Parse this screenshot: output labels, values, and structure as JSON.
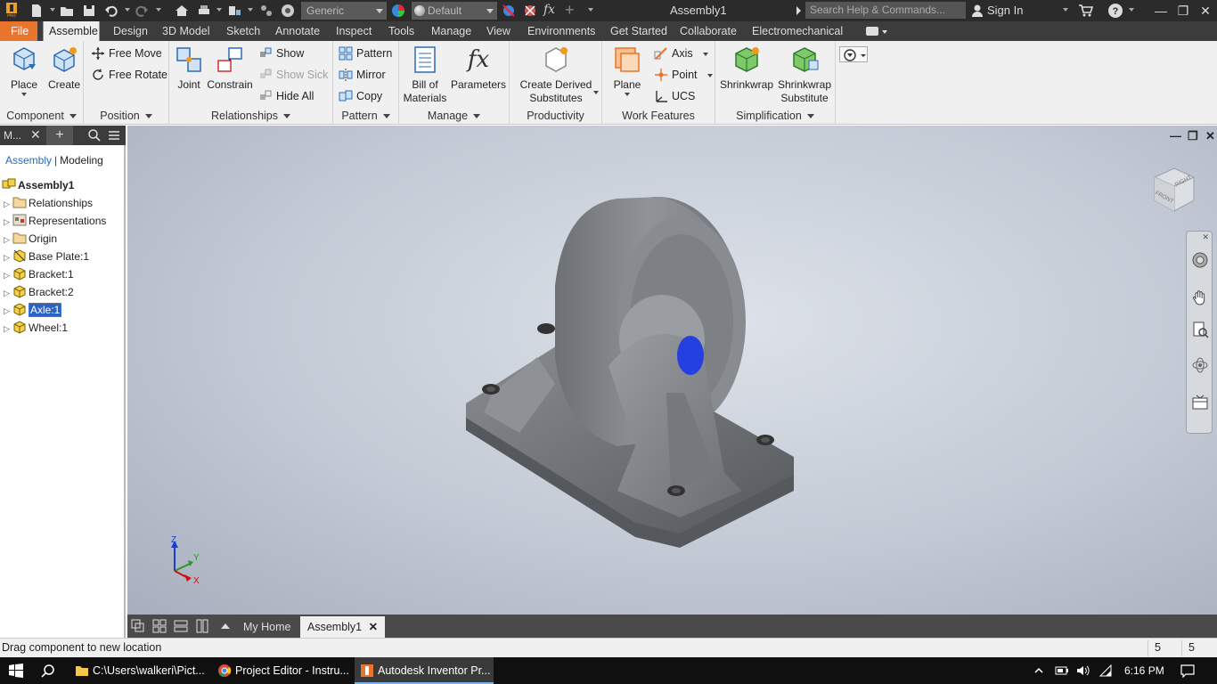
{
  "titlebar": {
    "material": "Generic",
    "appearance": "Default",
    "doc_title": "Assembly1",
    "search_placeholder": "Search Help & Commands...",
    "sign_in": "Sign In"
  },
  "ribbon_tabs": [
    "File",
    "Assemble",
    "Design",
    "3D Model",
    "Sketch",
    "Annotate",
    "Inspect",
    "Tools",
    "Manage",
    "View",
    "Environments",
    "Get Started",
    "Collaborate",
    "Electromechanical"
  ],
  "ribbon": {
    "component": {
      "title": "Component",
      "place": "Place",
      "create": "Create"
    },
    "position": {
      "title": "Position",
      "free_move": "Free Move",
      "free_rotate": "Free Rotate"
    },
    "relationships": {
      "title": "Relationships",
      "joint": "Joint",
      "constrain": "Constrain",
      "show": "Show",
      "show_sick": "Show Sick",
      "hide_all": "Hide All"
    },
    "pattern": {
      "title": "Pattern",
      "pattern": "Pattern",
      "mirror": "Mirror",
      "copy": "Copy"
    },
    "manage": {
      "title": "Manage",
      "bom_line1": "Bill of",
      "bom_line2": "Materials",
      "parameters": "Parameters"
    },
    "productivity": {
      "title": "Productivity",
      "line1": "Create Derived",
      "line2": "Substitutes"
    },
    "work_features": {
      "title": "Work Features",
      "plane": "Plane",
      "axis": "Axis",
      "point": "Point",
      "ucs": "UCS"
    },
    "simplification": {
      "title": "Simplification",
      "shrinkwrap": "Shrinkwrap",
      "sub_line1": "Shrinkwrap",
      "sub_line2": "Substitute"
    }
  },
  "browser": {
    "title": "M...",
    "tab_assembly": "Assembly",
    "tab_modeling": "Modeling",
    "root": "Assembly1",
    "items": [
      "Relationships",
      "Representations",
      "Origin",
      "Base Plate:1",
      "Bracket:1",
      "Bracket:2",
      "Axle:1",
      "Wheel:1"
    ],
    "selected": "Axle:1"
  },
  "viewcube": {
    "front": "FRONT",
    "right": "RIGHT"
  },
  "triad": {
    "x": "X",
    "y": "Y",
    "z": "Z"
  },
  "doc_tabs": {
    "home": "My Home",
    "assembly": "Assembly1"
  },
  "status": {
    "text": "Drag component to new location",
    "num1": "5",
    "num2": "5"
  },
  "taskbar": {
    "tasks": [
      "C:\\Users\\walkeri\\Pict...",
      "Project Editor - Instru...",
      "Autodesk Inventor Pr..."
    ],
    "time": "6:16 PM"
  },
  "colors": {
    "accent": "#e8742d",
    "selection": "#2a63c5",
    "highlight": "#2440e0"
  }
}
